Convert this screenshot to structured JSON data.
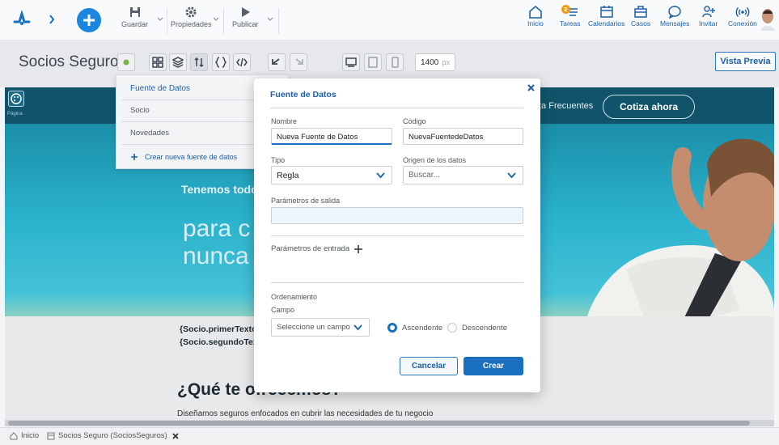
{
  "toolbar": {
    "save_label": "Guardar",
    "properties_label": "Propiedades",
    "publish_label": "Publicar"
  },
  "nav": {
    "inicio": "Inicio",
    "tareas": "Tareas",
    "tareas_badge": "2",
    "calendarios": "Calendarios",
    "casos": "Casos",
    "mensajes": "Mensajes",
    "invitar": "Invitar",
    "conexion": "Conexión"
  },
  "editor": {
    "site_title": "Socios Seguro",
    "width_value": "1400",
    "width_unit": "px",
    "preview_label": "Vista Previa",
    "page_label": "Página"
  },
  "datasources": {
    "header": "Fuente de Datos",
    "items": [
      "Socio",
      "Novedades"
    ],
    "create_label": "Crear nueva fuente de datos"
  },
  "page": {
    "faq_link": "ta Frecuentes",
    "cta_label": "Cotiza ahora",
    "hero_title": "Tenemos todo",
    "hero_big_1": "para c",
    "hero_big_2": "nunca",
    "socio_1": "{Socio.primerTexto",
    "socio_2": "{Socio.segundoTex",
    "section_title": "¿Qué te ofrecemos?",
    "section_text": "Diseñamos seguros enfocados en cubrir las necesidades de tu negocio"
  },
  "modal": {
    "title": "Fuente de Datos",
    "nombre_label": "Nombre",
    "nombre_value": "Nueva Fuente de Datos",
    "codigo_label": "Código",
    "codigo_value": "NuevaFuentedeDatos",
    "tipo_label": "Tipo",
    "tipo_value": "Regla",
    "origen_label": "Origen de los datos",
    "origen_placeholder": "Buscar...",
    "salida_label": "Parámetros de salida",
    "entrada_label": "Parámetros de entrada",
    "orden_label": "Ordenamiento",
    "campo_label": "Campo",
    "campo_placeholder": "Seleccione un campo",
    "asc_label": "Ascendente",
    "desc_label": "Descendente",
    "cancel_label": "Cancelar",
    "create_label": "Crear"
  },
  "bottom_tabs": {
    "home": "Inicio",
    "site": "Socios Seguro (SociosSeguros)"
  },
  "colors": {
    "accent": "#1b6fc1",
    "hero_dark": "#11546a",
    "hero_light": "#2ab2cc"
  }
}
